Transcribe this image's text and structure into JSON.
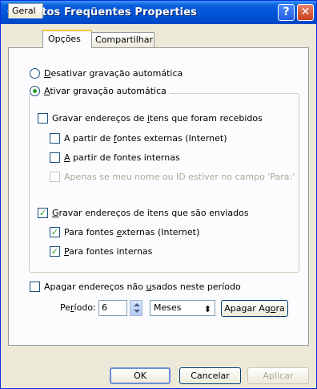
{
  "window": {
    "title": "Contatos Freqüentes Properties",
    "help_label": "?",
    "close_label": "✕"
  },
  "tabs": [
    {
      "label": "Geral",
      "active": false
    },
    {
      "label": "Opções",
      "active": true
    },
    {
      "label": "Compartilhar",
      "active": false
    }
  ],
  "options": {
    "disable_auto_save": {
      "mnemonic": "D",
      "rest": "esativar gravação automática",
      "selected": false
    },
    "enable_auto_save": {
      "mnemonic": "A",
      "rest": "tivar gravação automática",
      "selected": true
    },
    "save_received": {
      "pre": "Gravar endereços de ",
      "mnemonic": "i",
      "post": "tens que foram recebidos",
      "checked": false
    },
    "received_external": {
      "pre": "A partir de ",
      "mnemonic": "f",
      "post": "ontes externas (Internet)",
      "checked": false
    },
    "received_internal": {
      "mnemonic": "A",
      "post": " partir de fontes internas",
      "checked": false
    },
    "received_only_to": {
      "label": "Apenas se meu nome ou ID estiver no campo 'Para:'",
      "checked": false,
      "disabled": true
    },
    "save_sent": {
      "mnemonic": "G",
      "post": "ravar endereços de itens que são enviados",
      "checked": true
    },
    "sent_external": {
      "pre": "Para fontes ",
      "mnemonic": "e",
      "post": "xternas (Internet)",
      "checked": true
    },
    "sent_internal": {
      "mnemonic": "P",
      "post": "ara fontes internas",
      "checked": true
    },
    "delete_unused": {
      "pre": "Apagar endereços não ",
      "mnemonic": "u",
      "post": "sados neste período",
      "checked": false
    }
  },
  "period": {
    "label_pre": "Pe",
    "label_mnemonic": "r",
    "label_post": "íodo:",
    "value": "6",
    "unit": "Meses",
    "delete_now_pre": "Apagar Ag",
    "delete_now_mnemonic": "o",
    "delete_now_post": "ra"
  },
  "footer": {
    "ok": "OK",
    "cancel": "Cancelar",
    "apply": "Aplicar"
  }
}
